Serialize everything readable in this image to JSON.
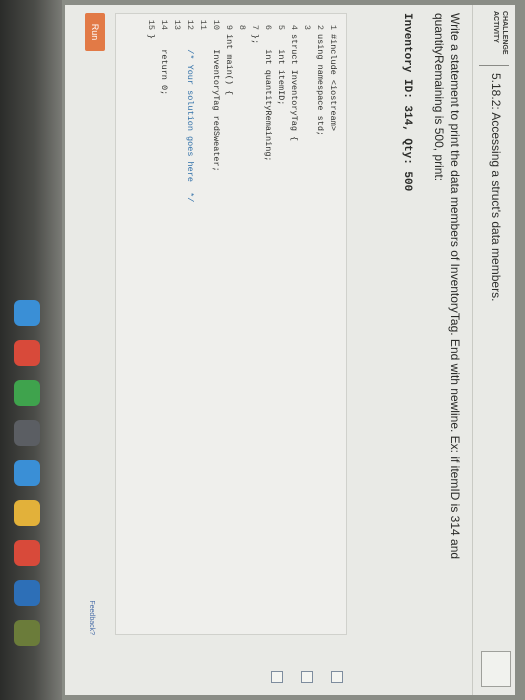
{
  "header": {
    "badge_line1": "CHALLENGE",
    "badge_line2": "ACTIVITY",
    "title": "5.18.2: Accessing a struct's data members."
  },
  "instructions": "Write a statement to print the data members of InventoryTag. End with newline. Ex: if itemID is 314 and quantityRemaining is 500, print:",
  "example_output": "Inventory ID: 314, Qty: 500",
  "code_lines": [
    {
      "n": "1",
      "text": "#include <iostream>"
    },
    {
      "n": "2",
      "text": "using namespace std;"
    },
    {
      "n": "3",
      "text": ""
    },
    {
      "n": "4",
      "text": "struct InventoryTag {"
    },
    {
      "n": "5",
      "text": "   int itemID;"
    },
    {
      "n": "6",
      "text": "   int quantityRemaining;"
    },
    {
      "n": "7",
      "text": "};"
    },
    {
      "n": "8",
      "text": ""
    },
    {
      "n": "9",
      "text": "int main() {"
    },
    {
      "n": "10",
      "text": "   InventoryTag redSweater;"
    },
    {
      "n": "11",
      "text": ""
    },
    {
      "n": "12",
      "text": "   /* Your solution goes here  */"
    },
    {
      "n": "13",
      "text": ""
    },
    {
      "n": "14",
      "text": "   return 0;"
    },
    {
      "n": "15",
      "text": "}"
    }
  ],
  "run_label": "Run",
  "feedback_label": "Feedback?",
  "colors": {
    "run_button": "#e27a46",
    "comment": "#2f6fa8",
    "screen_bg": "#e9eae6"
  }
}
